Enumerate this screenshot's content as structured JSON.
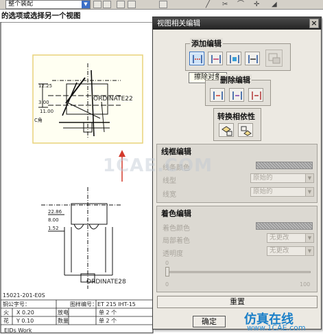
{
  "toolbar": {
    "assembly_select_value": "整个装配",
    "icons": [
      "layer-icon",
      "sketch-icon",
      "view-icon",
      "rect-icon",
      "line-icon",
      "scissors-icon",
      "arc-icon",
      "point-icon",
      "dim-icon"
    ]
  },
  "drawing": {
    "prompt": "的选项或选择另一个视图",
    "top_labels": [
      "12.25",
      "3.00",
      "11.00",
      "C角"
    ],
    "ordinate_top": "ORDINATE22",
    "bottom_labels": [
      "22.86",
      "8.00",
      "1.52"
    ],
    "ordinate_bottom": "ORDINATE28",
    "part_number": "15021-201-E0S",
    "table_rows": [
      [
        "铜公字号：",
        "",
        "图样编号：",
        "ET 215 IHT-15"
      ],
      [
        "火",
        "X 0.20",
        "放电",
        "单 2 个"
      ],
      [
        "花",
        "Y 0.10",
        "数量",
        "单 2 个"
      ]
    ],
    "footer_text": "EIDs Work"
  },
  "dialog": {
    "title": "视图相关编辑",
    "close_label": "×",
    "add_edit": {
      "title": "添加编辑",
      "tooltip": "擦除对象"
    },
    "delete_edit": {
      "title": "删除编辑"
    },
    "convert": {
      "title": "转换相依性"
    },
    "line_edit": {
      "title": "线框编辑",
      "color_label": "线条颜色",
      "font_label": "线型",
      "font_value": "原始的",
      "width_label": "线宽",
      "width_value": "原始的"
    },
    "shade_edit": {
      "title": "着色编辑",
      "color_label": "着色颜色",
      "local_label": "局部着色",
      "local_value": "无更改",
      "transparency_label": "透明度",
      "transparency_value": "无更改",
      "slider_min": "0",
      "slider_max": "100",
      "slider_level": 0
    },
    "reset_label": "重置",
    "ok_label": "确定"
  },
  "watermarks": {
    "center": "1CAE.COM",
    "brand": "仿真在线",
    "url": "www.1CAE.com"
  },
  "colors": {
    "active_icon": "#2f6fc2",
    "title_bar": "#2a2a2a",
    "arrow": "#d33a2c",
    "brand": "#1a7fc8"
  }
}
